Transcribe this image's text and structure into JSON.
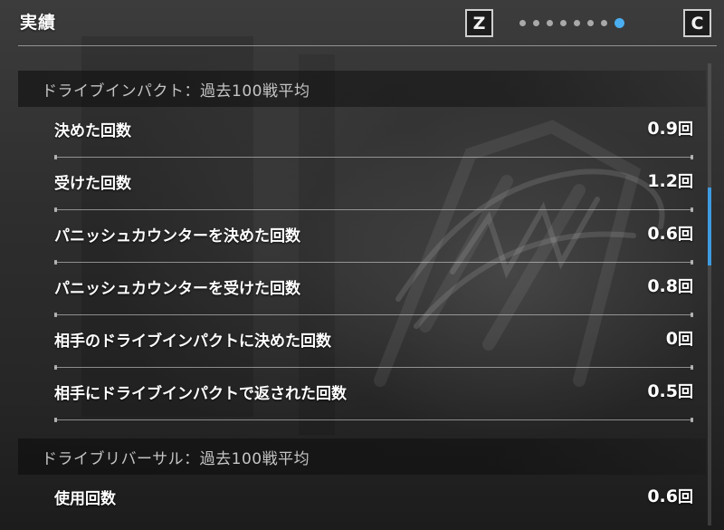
{
  "header": {
    "title": "実績",
    "prev_key": "Z",
    "next_key": "C",
    "page_dots": {
      "total": 8,
      "active_index": 7
    }
  },
  "sections": [
    {
      "title": "ドライブインパクト：過去100戦平均",
      "rows": [
        {
          "label": "決めた回数",
          "value": "0.9",
          "unit": "回"
        },
        {
          "label": "受けた回数",
          "value": "1.2",
          "unit": "回"
        },
        {
          "label": "パニッシュカウンターを決めた回数",
          "value": "0.6",
          "unit": "回"
        },
        {
          "label": "パニッシュカウンターを受けた回数",
          "value": "0.8",
          "unit": "回"
        },
        {
          "label": "相手のドライブインパクトに決めた回数",
          "value": "0",
          "unit": "回"
        },
        {
          "label": "相手にドライブインパクトで返された回数",
          "value": "0.5",
          "unit": "回"
        }
      ]
    },
    {
      "title": "ドライブリバーサル：過去100戦平均",
      "rows": [
        {
          "label": "使用回数",
          "value": "0.6",
          "unit": "回"
        }
      ]
    }
  ],
  "scrollbar": {
    "position_fraction": 0.27,
    "visible_fraction": 0.17
  },
  "colors": {
    "accent": "#4aaef0",
    "text": "#ffffff",
    "section_text": "#c4c4c4"
  }
}
